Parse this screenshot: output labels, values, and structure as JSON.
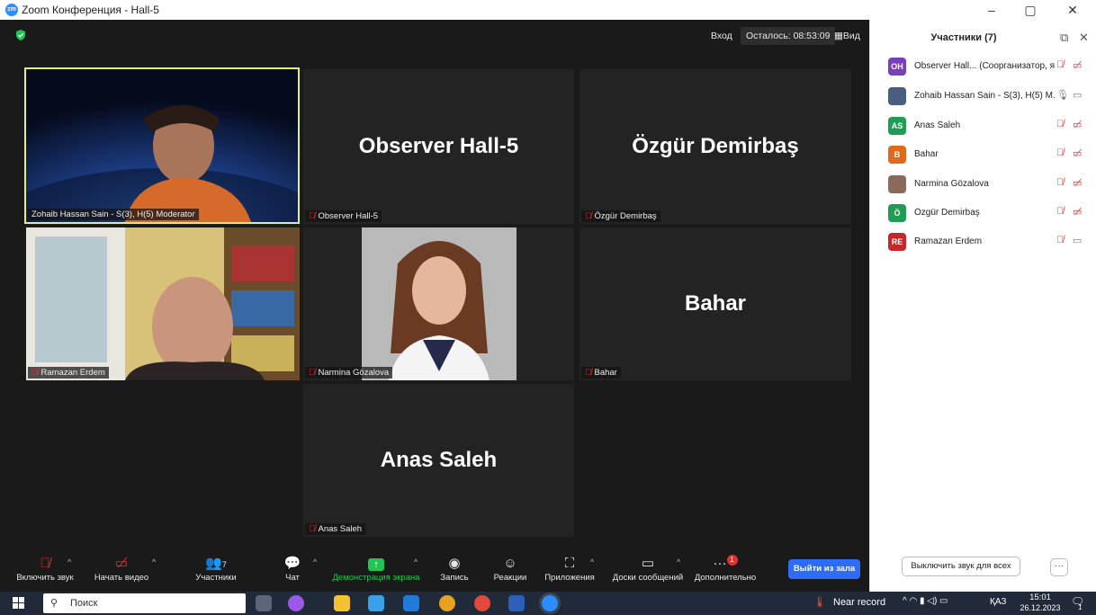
{
  "window": {
    "title": "Zoom Конференция - Hall-5",
    "app_icon": "zoom-icon"
  },
  "meeting_bar": {
    "enter": "Вход",
    "remaining": "Осталось: 08:53:09",
    "view": "Вид"
  },
  "tiles": [
    {
      "label": "Zohaib Hassan Sain - S(3), H(5) Moderator",
      "video": true,
      "active_speaker": true
    },
    {
      "label": "Observer  Hall-5",
      "big_name": "Observer  Hall-5",
      "muted": true
    },
    {
      "label": "Özgür Demirbaş",
      "big_name": "Özgür Demirbaş",
      "muted": true
    },
    {
      "label": "Ramazan Erdem",
      "video": true,
      "muted": true
    },
    {
      "label": "Narmina Gözalova",
      "video": true,
      "muted": true
    },
    {
      "label": "Bahar",
      "big_name": "Bahar",
      "muted": true
    },
    {
      "label": "Anas  Saleh",
      "big_name": "Anas  Saleh",
      "muted": true
    }
  ],
  "participants_panel": {
    "title": "Участники (7)",
    "items": [
      {
        "initials": "OH",
        "color": "#7b3fbd",
        "name": "Observer  Hall... (Соорганизатор, я)",
        "mic": "muted",
        "cam": "off"
      },
      {
        "initials": "",
        "color": "#4a5f80",
        "name": "Zohaib Hassan Sain - S(3), H(5) M...",
        "mic": "on",
        "cam": "on"
      },
      {
        "initials": "AS",
        "color": "#1f9d55",
        "name": "Anas  Saleh",
        "mic": "muted",
        "cam": "off"
      },
      {
        "initials": "B",
        "color": "#e06a1b",
        "name": "Bahar",
        "mic": "muted",
        "cam": "off"
      },
      {
        "initials": "",
        "color": "#8a6a5a",
        "name": "Narmina Gözalova",
        "mic": "muted",
        "cam": "off"
      },
      {
        "initials": "Ö",
        "color": "#1f9d55",
        "name": "Özgür Demirbaş",
        "mic": "muted",
        "cam": "off"
      },
      {
        "initials": "RE",
        "color": "#c62828",
        "name": "Ramazan Erdem",
        "mic": "muted",
        "cam": "on"
      }
    ],
    "mute_all": "Выключить звук для всех",
    "more": "···"
  },
  "toolbar": {
    "unmute": "Включить звук",
    "start_video": "Начать видео",
    "participants": "Участники",
    "participants_count": "7",
    "chat": "Чат",
    "share_screen": "Демонстрация экрана",
    "record": "Запись",
    "reactions": "Реакции",
    "apps": "Приложения",
    "whiteboards": "Доски сообщений",
    "more": "Дополнительно",
    "more_badge": "1",
    "leave": "Выйти из зала"
  },
  "taskbar": {
    "search": "Поиск",
    "weather": "Near record",
    "lang": "ҚАЗ",
    "time": "15:01",
    "date": "26.12.2023",
    "notifications": "1"
  },
  "colors": {
    "accent": "#2d6cf6",
    "share_green": "#23c552",
    "mute_red": "#e0312f",
    "speaker_border": "#e4f07a"
  }
}
